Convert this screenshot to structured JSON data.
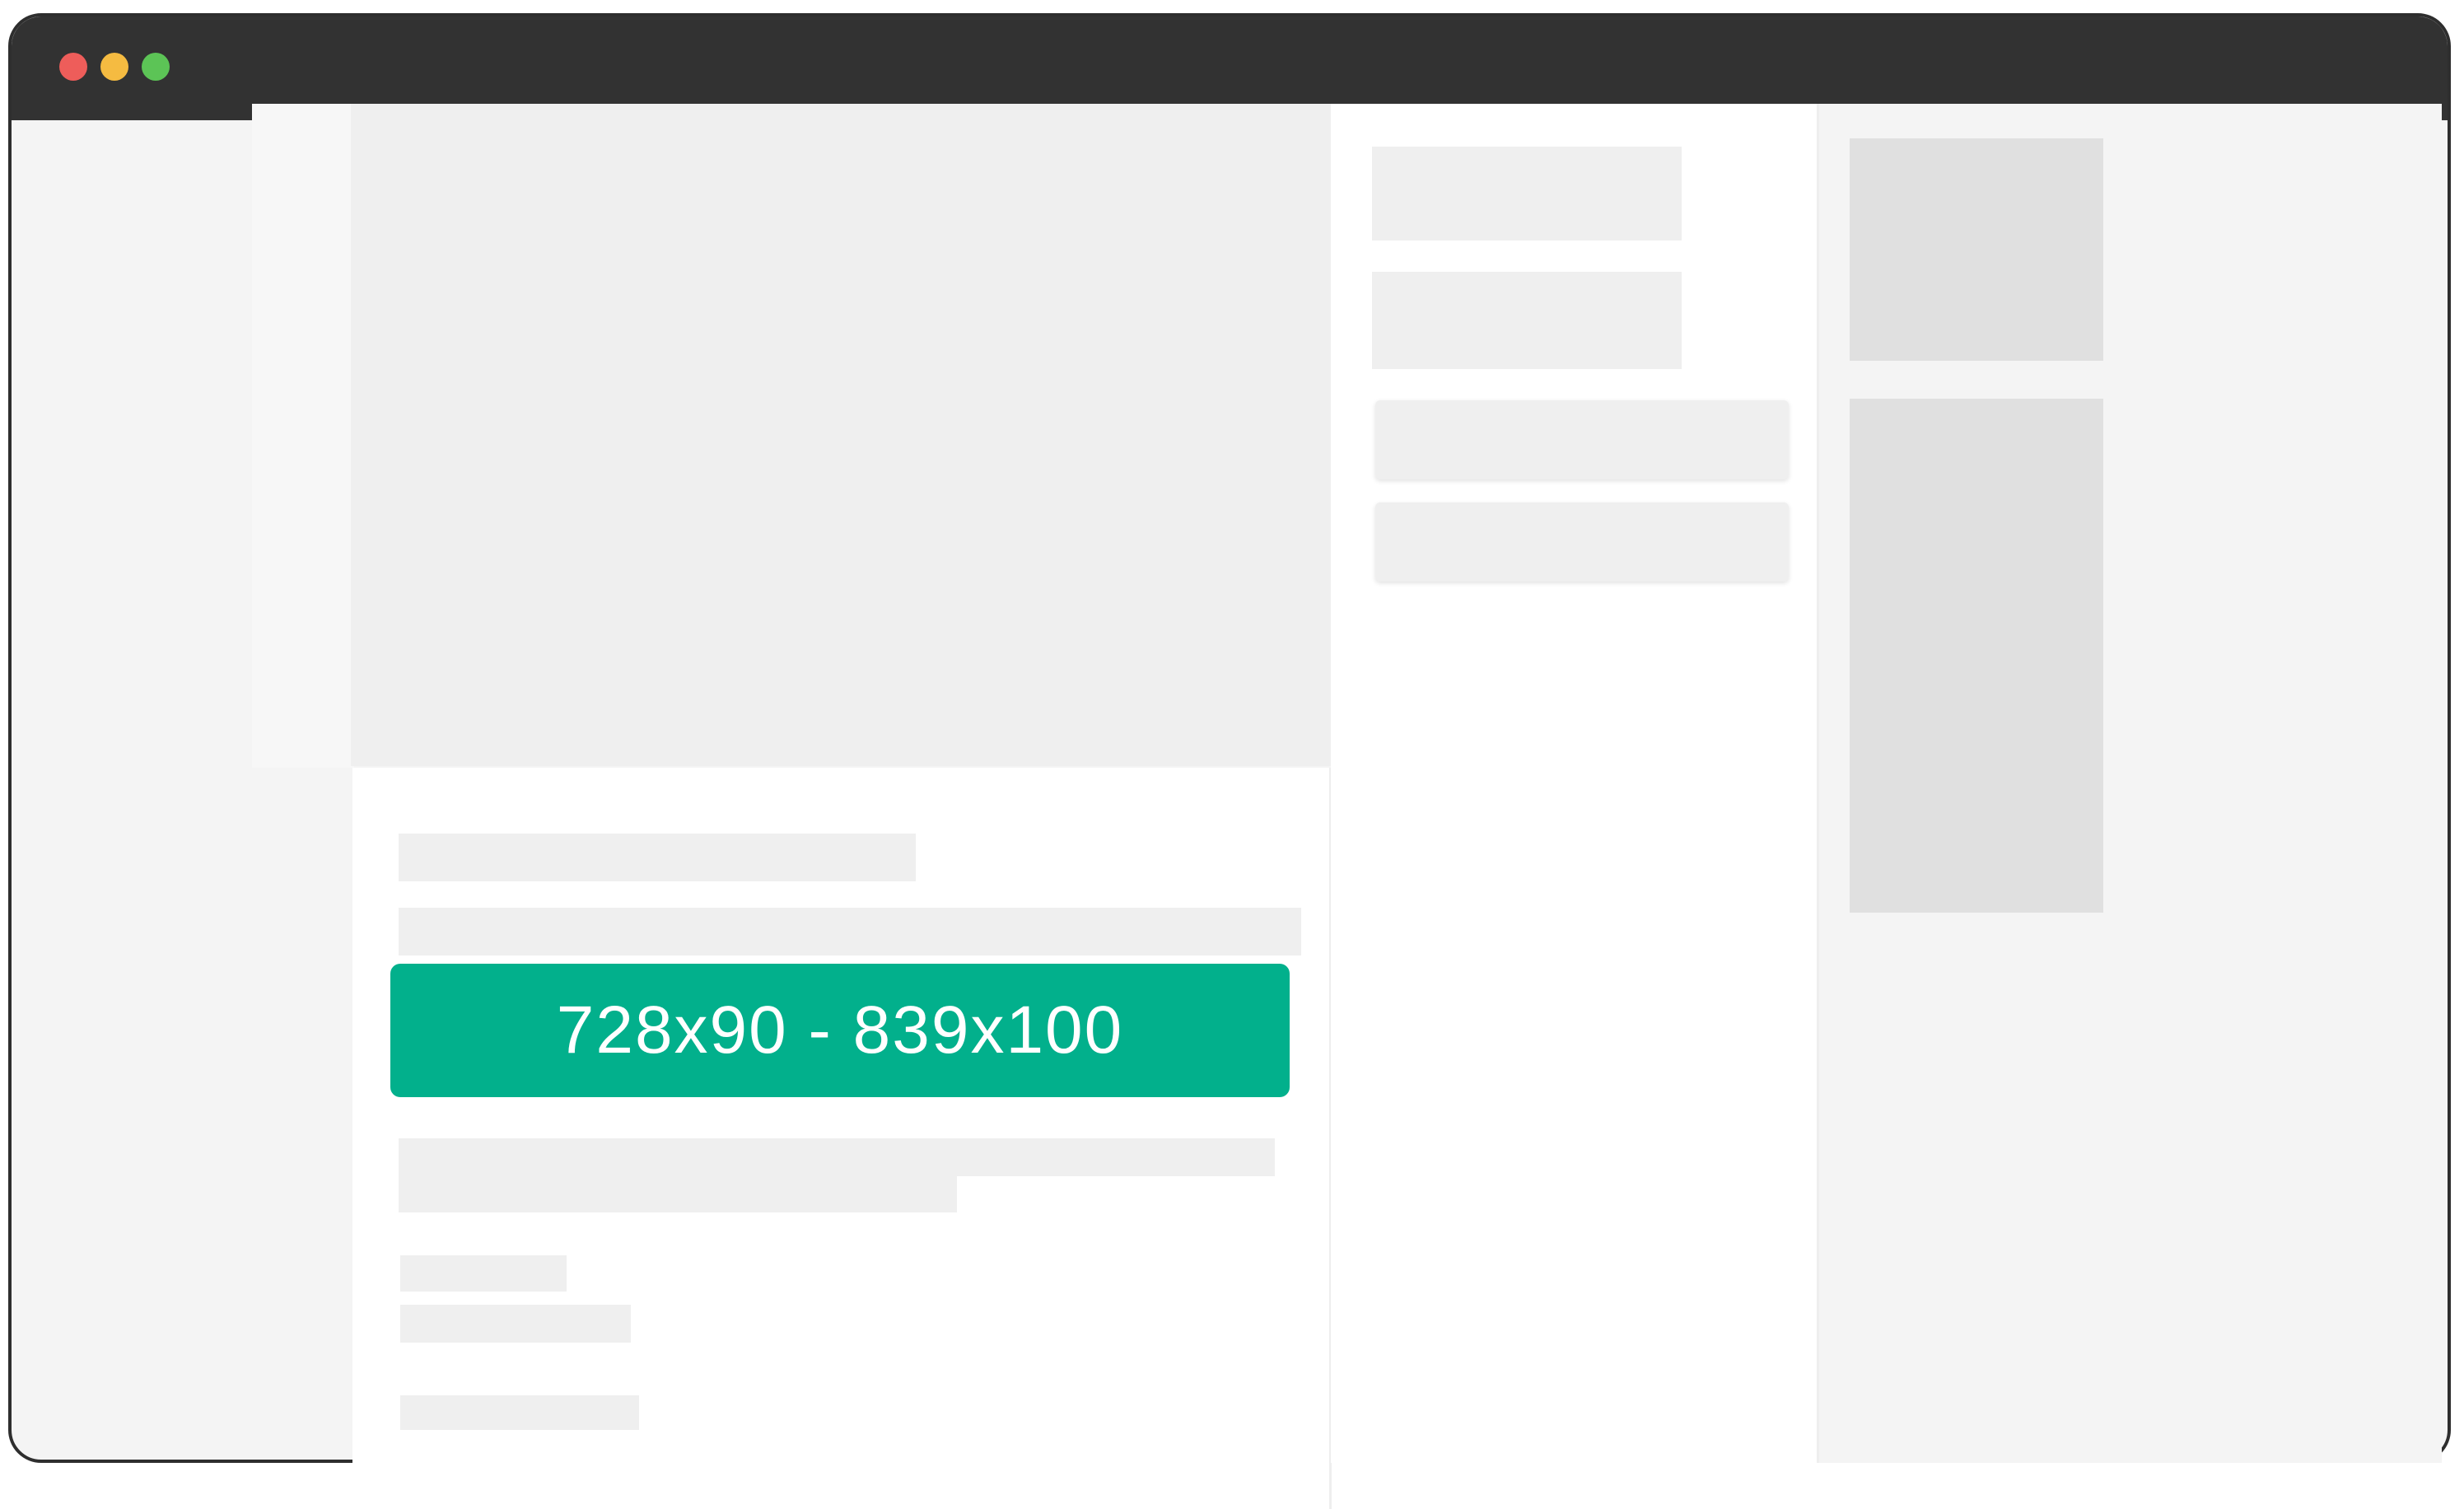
{
  "window": {
    "controls": [
      "close-dot",
      "minimize-dot",
      "maximize-dot"
    ]
  },
  "colors": {
    "titlebar": "#323232",
    "close": "#ee5d5a",
    "minimize": "#f5bb41",
    "maximize": "#5cc456",
    "ad_background": "#02b08c",
    "placeholder": "#efefef",
    "sidebar_block": "#e0e0e0"
  },
  "ad_banner": {
    "label": "728x90 - 839x100"
  }
}
